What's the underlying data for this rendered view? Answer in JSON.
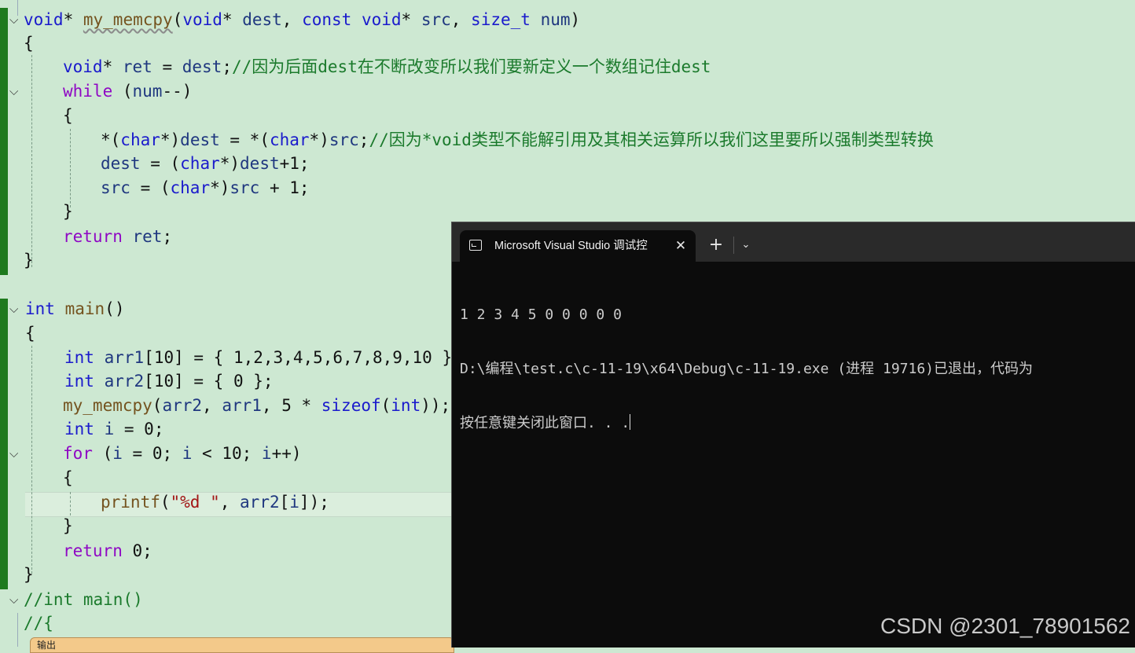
{
  "editor": {
    "lines": [
      {
        "fold": true,
        "tokens": [
          {
            "t": "void",
            "c": "kw"
          },
          {
            "t": "* ",
            "c": ""
          },
          {
            "t": "my_memcpy",
            "c": "fn-squig"
          },
          {
            "t": "(",
            "c": ""
          },
          {
            "t": "void",
            "c": "kw"
          },
          {
            "t": "* ",
            "c": ""
          },
          {
            "t": "dest",
            "c": "var"
          },
          {
            "t": ", ",
            "c": ""
          },
          {
            "t": "const ",
            "c": "kw"
          },
          {
            "t": "void",
            "c": "kw"
          },
          {
            "t": "* ",
            "c": ""
          },
          {
            "t": "src",
            "c": "var"
          },
          {
            "t": ", ",
            "c": ""
          },
          {
            "t": "size_t ",
            "c": "kw"
          },
          {
            "t": "num",
            "c": "var"
          },
          {
            "t": ")",
            "c": ""
          }
        ]
      },
      {
        "fold": false,
        "tokens": [
          {
            "t": "{",
            "c": ""
          }
        ]
      },
      {
        "fold": false,
        "tokens": [
          {
            "t": "void",
            "c": "kw"
          },
          {
            "t": "* ",
            "c": ""
          },
          {
            "t": "ret",
            "c": "var"
          },
          {
            "t": " = ",
            "c": ""
          },
          {
            "t": "dest",
            "c": "var"
          },
          {
            "t": ";",
            "c": ""
          },
          {
            "t": "//因为后面dest在不断改变所以我们要新定义一个数组记住dest",
            "c": "cm"
          }
        ]
      },
      {
        "fold": true,
        "tokens": [
          {
            "t": "while",
            "c": "ctl"
          },
          {
            "t": " (",
            "c": ""
          },
          {
            "t": "num",
            "c": "var"
          },
          {
            "t": "--)",
            "c": ""
          }
        ]
      },
      {
        "fold": false,
        "tokens": [
          {
            "t": "{",
            "c": ""
          }
        ]
      },
      {
        "fold": false,
        "tokens": [
          {
            "t": "*(",
            "c": ""
          },
          {
            "t": "char",
            "c": "kw"
          },
          {
            "t": "*)",
            "c": ""
          },
          {
            "t": "dest",
            "c": "var"
          },
          {
            "t": " = *(",
            "c": ""
          },
          {
            "t": "char",
            "c": "kw"
          },
          {
            "t": "*)",
            "c": ""
          },
          {
            "t": "src",
            "c": "var"
          },
          {
            "t": ";",
            "c": ""
          },
          {
            "t": "//因为*void类型不能解引用及其相关运算所以我们这里要所以强制类型转换",
            "c": "cm"
          }
        ]
      },
      {
        "fold": false,
        "tokens": [
          {
            "t": "dest",
            "c": "var"
          },
          {
            "t": " = (",
            "c": ""
          },
          {
            "t": "char",
            "c": "kw"
          },
          {
            "t": "*)",
            "c": ""
          },
          {
            "t": "dest",
            "c": "var"
          },
          {
            "t": "+1;",
            "c": ""
          }
        ]
      },
      {
        "fold": false,
        "tokens": [
          {
            "t": "src",
            "c": "var"
          },
          {
            "t": " = (",
            "c": ""
          },
          {
            "t": "char",
            "c": "kw"
          },
          {
            "t": "*)",
            "c": ""
          },
          {
            "t": "src",
            "c": "var"
          },
          {
            "t": " + 1;",
            "c": ""
          }
        ]
      },
      {
        "fold": false,
        "tokens": [
          {
            "t": "}",
            "c": ""
          }
        ]
      },
      {
        "fold": false,
        "tokens": [
          {
            "t": "return",
            "c": "ctl"
          },
          {
            "t": " ",
            "c": ""
          },
          {
            "t": "ret",
            "c": "var"
          },
          {
            "t": ";",
            "c": ""
          }
        ]
      },
      {
        "fold": false,
        "tokens": [
          {
            "t": "}",
            "c": ""
          }
        ]
      },
      {
        "fold": false,
        "tokens": []
      },
      {
        "fold": true,
        "tokens": [
          {
            "t": "int",
            "c": "kw"
          },
          {
            "t": " ",
            "c": ""
          },
          {
            "t": "main",
            "c": "fn"
          },
          {
            "t": "()",
            "c": ""
          }
        ]
      },
      {
        "fold": false,
        "tokens": [
          {
            "t": "{",
            "c": ""
          }
        ]
      },
      {
        "fold": false,
        "tokens": [
          {
            "t": "int",
            "c": "kw"
          },
          {
            "t": " ",
            "c": ""
          },
          {
            "t": "arr1",
            "c": "var"
          },
          {
            "t": "[10] = { 1,2,3,4,5,6,7,8,9,10 };",
            "c": ""
          }
        ]
      },
      {
        "fold": false,
        "tokens": [
          {
            "t": "int",
            "c": "kw"
          },
          {
            "t": " ",
            "c": ""
          },
          {
            "t": "arr2",
            "c": "var"
          },
          {
            "t": "[10] = { 0 };",
            "c": ""
          }
        ]
      },
      {
        "fold": false,
        "tokens": [
          {
            "t": "my_memcpy",
            "c": "fn"
          },
          {
            "t": "(",
            "c": ""
          },
          {
            "t": "arr2",
            "c": "var"
          },
          {
            "t": ", ",
            "c": ""
          },
          {
            "t": "arr1",
            "c": "var"
          },
          {
            "t": ", 5 * ",
            "c": ""
          },
          {
            "t": "sizeof",
            "c": "kw"
          },
          {
            "t": "(",
            "c": ""
          },
          {
            "t": "int",
            "c": "kw"
          },
          {
            "t": "));",
            "c": ""
          }
        ]
      },
      {
        "fold": false,
        "tokens": [
          {
            "t": "int",
            "c": "kw"
          },
          {
            "t": " ",
            "c": ""
          },
          {
            "t": "i",
            "c": "var"
          },
          {
            "t": " = 0;",
            "c": ""
          }
        ]
      },
      {
        "fold": true,
        "tokens": [
          {
            "t": "for",
            "c": "ctl"
          },
          {
            "t": " (",
            "c": ""
          },
          {
            "t": "i",
            "c": "var"
          },
          {
            "t": " = 0; ",
            "c": ""
          },
          {
            "t": "i",
            "c": "var"
          },
          {
            "t": " < 10; ",
            "c": ""
          },
          {
            "t": "i",
            "c": "var"
          },
          {
            "t": "++)",
            "c": ""
          }
        ]
      },
      {
        "fold": false,
        "tokens": [
          {
            "t": "{",
            "c": ""
          }
        ]
      },
      {
        "fold": false,
        "tokens": [
          {
            "t": "printf",
            "c": "fn"
          },
          {
            "t": "(",
            "c": ""
          },
          {
            "t": "\"%d \"",
            "c": "str"
          },
          {
            "t": ", ",
            "c": ""
          },
          {
            "t": "arr2",
            "c": "var"
          },
          {
            "t": "[",
            "c": ""
          },
          {
            "t": "i",
            "c": "var"
          },
          {
            "t": "]);",
            "c": ""
          }
        ]
      },
      {
        "fold": false,
        "tokens": [
          {
            "t": "}",
            "c": ""
          }
        ]
      },
      {
        "fold": false,
        "tokens": [
          {
            "t": "return",
            "c": "ctl"
          },
          {
            "t": " 0;",
            "c": ""
          }
        ]
      },
      {
        "fold": false,
        "tokens": [
          {
            "t": "}",
            "c": ""
          }
        ]
      },
      {
        "fold": true,
        "tokens": [
          {
            "t": "//int main()",
            "c": "cm"
          }
        ]
      },
      {
        "fold": false,
        "tokens": [
          {
            "t": "//{",
            "c": "cm"
          }
        ]
      }
    ],
    "output_tab_label": "输出"
  },
  "terminal": {
    "tab_title": "Microsoft Visual Studio 调试控",
    "close_symbol": "✕",
    "new_tab_symbol": "+",
    "dropdown_symbol": "⌄",
    "output_lines": [
      "1 2 3 4 5 0 0 0 0 0",
      "D:\\编程\\test.c\\c-11-19\\x64\\Debug\\c-11-19.exe (进程 19716)已退出，代码为",
      "按任意键关闭此窗口. . ."
    ]
  },
  "watermark": "CSDN @2301_78901562",
  "colors": {
    "editor_bg": "#cde8d2",
    "keyword": "#1a1acc",
    "control": "#8f08c4",
    "function": "#74531f",
    "comment": "#1b7a2c",
    "string": "#a31515",
    "terminal_bg": "#0c0c0c"
  }
}
